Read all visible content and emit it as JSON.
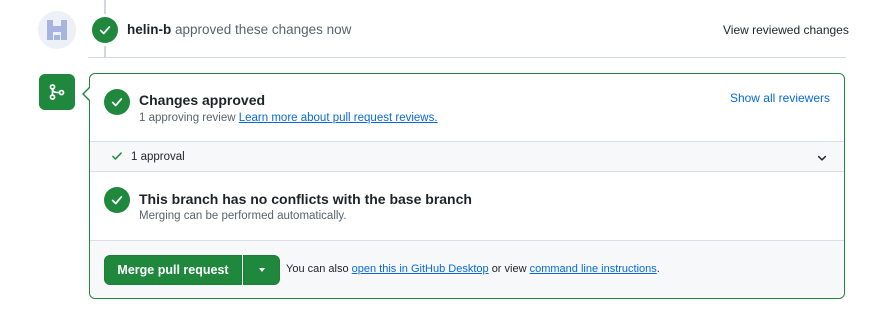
{
  "event": {
    "author": "helin-b",
    "action": "approved these changes now",
    "view_changes_label": "View reviewed changes"
  },
  "approval": {
    "title": "Changes approved",
    "subtitle_prefix": "1 approving review",
    "learn_more_link": "Learn more about pull request reviews.",
    "show_all_label": "Show all reviewers",
    "approvals_count_label": "1 approval"
  },
  "conflicts": {
    "title": "This branch has no conflicts with the base branch",
    "subtitle": "Merging can be performed automatically."
  },
  "merge": {
    "button_label": "Merge pull request",
    "note_prefix": "You can also",
    "desktop_link": "open this in GitHub Desktop",
    "note_middle": "or view",
    "cli_link": "command line instructions",
    "note_suffix": "."
  },
  "icons": {
    "avatar": "identicon-avatar",
    "event": "check-circle-icon",
    "merge": "git-merge-icon",
    "approval": "check-circle-icon",
    "approvals_row": "check-icon",
    "expand": "chevron-down-icon",
    "conflicts": "check-circle-icon",
    "merge_dropdown": "triangle-down-icon"
  },
  "colors": {
    "success": "#1f883d",
    "link": "#0969da",
    "muted_text": "#59636e",
    "border": "#d0d7de"
  }
}
